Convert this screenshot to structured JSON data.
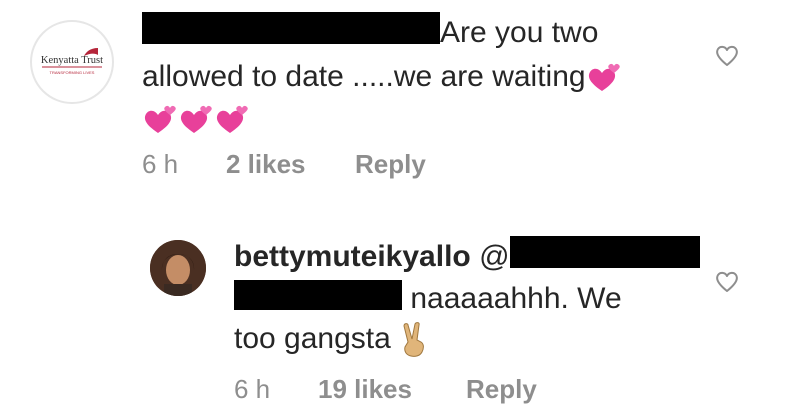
{
  "comment1": {
    "avatar_label": "Kenyatta Trust",
    "avatar_sublabel": "TRANSFORMING LIVES",
    "text_line1": "Are you two",
    "text_line2": "allowed to date .....we are waiting",
    "time": "6 h",
    "likes": "2 likes",
    "reply": "Reply",
    "emojis": [
      "two-hearts",
      "two-hearts",
      "two-hearts",
      "two-hearts"
    ]
  },
  "comment2": {
    "username": "bettymuteikyallo",
    "mention": "@",
    "text_line1": "naaaaahhh. We",
    "text_line2": "too gangsta",
    "time": "6 h",
    "likes": "19 likes",
    "reply": "Reply",
    "emojis": [
      "victory-hand"
    ]
  },
  "colors": {
    "text": "#262626",
    "meta": "#8e8e8e",
    "heart_emoji": "#e8409a",
    "brand_red": "#b5253a"
  }
}
